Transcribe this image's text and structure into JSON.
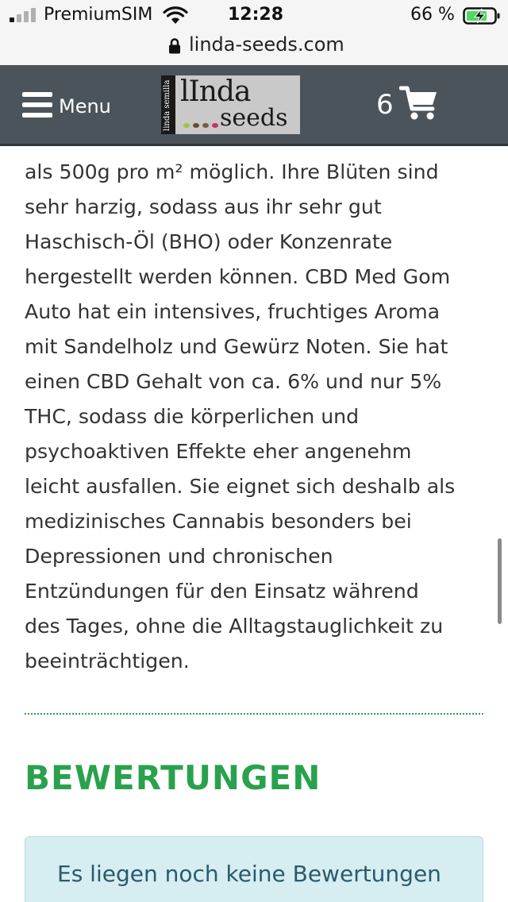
{
  "status_bar": {
    "carrier": "PremiumSIM",
    "time": "12:28",
    "battery_percent": "66 %",
    "icons": [
      "signal-icon",
      "wifi-icon",
      "battery-charging-icon"
    ]
  },
  "browser": {
    "url": "linda-seeds.com",
    "icons": [
      "lock-icon"
    ]
  },
  "header": {
    "menu_label": "Menu",
    "logo": {
      "side_text": "linda semilla",
      "word1": "lInda",
      "word2": "seeds"
    },
    "cart_count": "6",
    "colors": {
      "background": "#4b545a",
      "text": "#ffffff"
    }
  },
  "description": {
    "lines": [
      "als 500g pro m² möglich. Ihre Blüten sind",
      "sehr harzig, sodass aus ihr sehr gut",
      "Haschisch-Öl (BHO) oder Konzenrate",
      "hergestellt werden können. CBD Med Gom",
      "Auto hat ein intensives, fruchtiges Aroma",
      "mit Sandelholz und Gewürz Noten. Sie hat",
      "einen CBD Gehalt von ca. 6% und nur 5%",
      "THC, sodass die körperlichen und",
      "psychoaktiven Effekte eher angenehm",
      "leicht ausfallen. Sie eignet sich deshalb als",
      "medizinisches Cannabis besonders bei",
      "Depressionen und chronischen",
      "Entzündungen für den Einsatz während",
      "des Tages, ohne die Alltagstauglichkeit zu",
      "beeinträchtigen."
    ]
  },
  "reviews": {
    "heading": "BEWERTUNGEN",
    "notice": "Es liegen noch keine Bewertungen",
    "colors": {
      "accent": "#2aa14d",
      "notice_bg": "#d6edf2",
      "notice_text": "#2b5a6b"
    }
  }
}
